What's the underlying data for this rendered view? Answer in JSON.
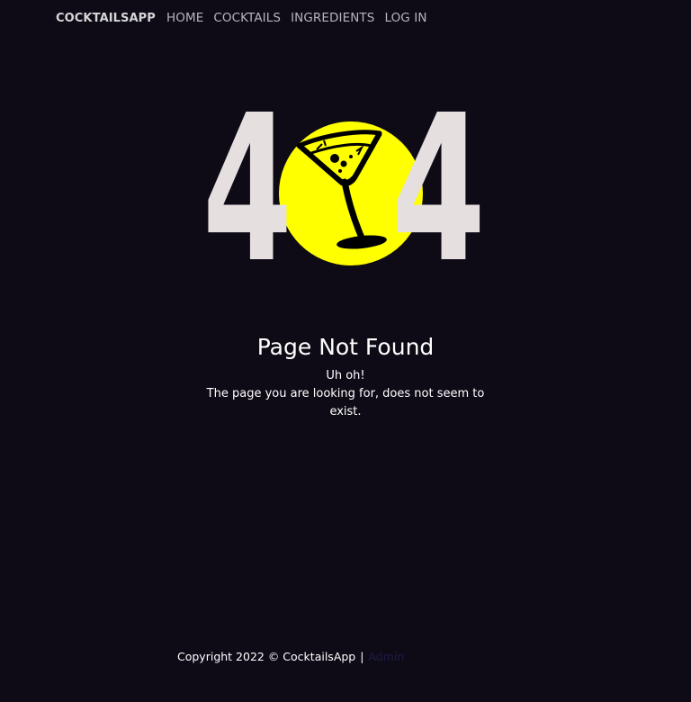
{
  "nav": {
    "brand": "COCKTAILSAPP",
    "links": [
      "HOME",
      "COCKTAILS",
      "INGREDIENTS",
      "LOG IN"
    ]
  },
  "hero": {
    "digit_left": "4",
    "digit_right": "4",
    "icon": "martini-glass-icon",
    "colors": {
      "digits": "#e6dfe0",
      "circle": "#ffff00",
      "glass": "#000000"
    }
  },
  "message": {
    "title": "Page Not Found",
    "subtitle": "Uh oh!",
    "description": "The page you are looking for, does not seem to exist."
  },
  "footer": {
    "copyright": "Copyright 2022 © CocktailsApp",
    "separator": "|",
    "admin_link": "Admin"
  },
  "colors": {
    "background": "#0e0b16",
    "text": "#ffffff",
    "nav_text": "#b8b4be",
    "admin_link": "#1f1b4a"
  }
}
